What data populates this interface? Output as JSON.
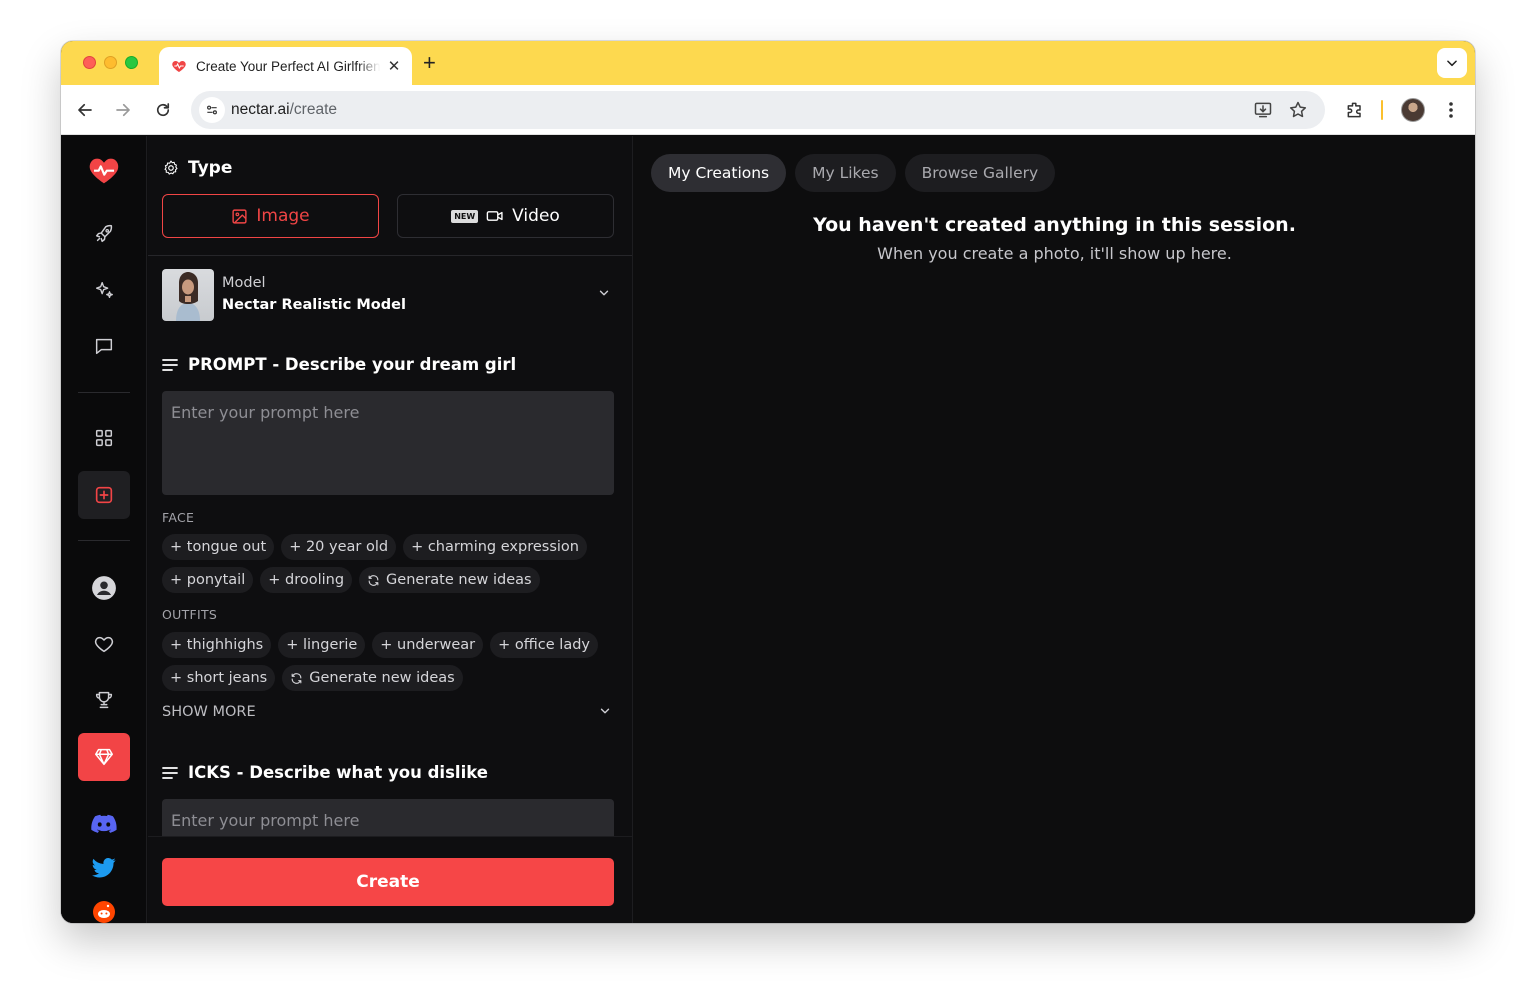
{
  "browser": {
    "tab_title": "Create Your Perfect AI Girlfriend",
    "new_tab_label": "+",
    "url_domain": "nectar.ai",
    "url_path": "/create"
  },
  "panel": {
    "type_heading": "Type",
    "image_label": "Image",
    "video_badge": "NEW",
    "video_label": "Video",
    "model_label": "Model",
    "model_value": "Nectar Realistic Model",
    "prompt_heading": "PROMPT - Describe your dream girl",
    "prompt_placeholder": "Enter your prompt here",
    "face_label": "FACE",
    "face_chips": [
      "+ tongue out",
      "+ 20 year old",
      "+ charming expression",
      "+ ponytail",
      "+ drooling"
    ],
    "generate_label": "Generate new ideas",
    "outfits_label": "OUTFITS",
    "outfit_chips": [
      "+ thighhighs",
      "+ lingerie",
      "+ underwear",
      "+ office lady",
      "+ short jeans"
    ],
    "show_more": "SHOW MORE",
    "icks_heading": "ICKS - Describe what you dislike",
    "icks_placeholder": "Enter your prompt here",
    "create_label": "Create"
  },
  "gallery": {
    "tabs": [
      "My Creations",
      "My Likes",
      "Browse Gallery"
    ],
    "active_tab": "My Creations",
    "empty_title": "You haven't created anything in this session.",
    "empty_sub": "When you create a photo, it'll show up here."
  },
  "colors": {
    "tab_strip": "#fdd94f",
    "accent_red": "#f64647",
    "app_bg": "#0d0d0e"
  }
}
